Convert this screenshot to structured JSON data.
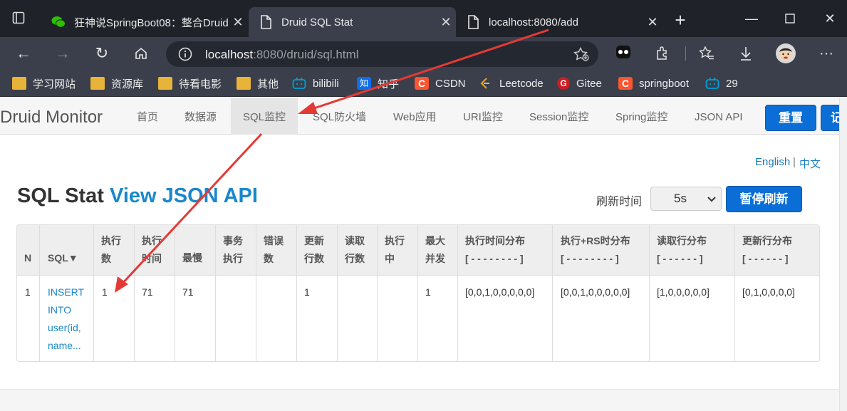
{
  "browser": {
    "tabs": [
      {
        "label": "狂神说SpringBoot08：整合Druid",
        "icon": "wechat-icon",
        "active": false
      },
      {
        "label": "Druid SQL Stat",
        "icon": "page-icon",
        "active": true
      },
      {
        "label": "localhost:8080/add",
        "icon": "page-icon",
        "active": false
      }
    ],
    "address": {
      "host": "localhost",
      "rest": ":8080/druid/sql.html"
    },
    "bookmarks": [
      {
        "label": "学习网站",
        "icon": "folder-icon"
      },
      {
        "label": "资源库",
        "icon": "folder-icon"
      },
      {
        "label": "待看电影",
        "icon": "folder-icon"
      },
      {
        "label": "其他",
        "icon": "folder-icon"
      },
      {
        "label": "bilibili",
        "icon": "bilibili-icon"
      },
      {
        "label": "知乎",
        "icon": "zhihu-icon"
      },
      {
        "label": "CSDN",
        "icon": "csdn-icon"
      },
      {
        "label": "Leetcode",
        "icon": "leetcode-icon"
      },
      {
        "label": "Gitee",
        "icon": "gitee-icon"
      },
      {
        "label": "springboot",
        "icon": "csdn-icon"
      },
      {
        "label": "29",
        "icon": "bilibili-icon"
      }
    ]
  },
  "druid": {
    "brand": "Druid Monitor",
    "menu": [
      "首页",
      "数据源",
      "SQL监控",
      "SQL防火墙",
      "Web应用",
      "URI监控",
      "Session监控",
      "Spring监控",
      "JSON API"
    ],
    "active_menu": "SQL监控",
    "reset_label": "重置",
    "extra_label": "记",
    "lang_en": "English",
    "lang_sep": "|",
    "lang_zh": "中文",
    "title": "SQL Stat",
    "title_link": "View JSON API",
    "refresh_label": "刷新时间",
    "refresh_value": "5s",
    "pause_label": "暂停刷新",
    "table": {
      "headers": [
        [
          "N"
        ],
        [
          "SQL▼"
        ],
        [
          "执行",
          "数"
        ],
        [
          "执行",
          "时间"
        ],
        [
          "最慢"
        ],
        [
          "事务",
          "执行"
        ],
        [
          "错误",
          "数"
        ],
        [
          "更新",
          "行数"
        ],
        [
          "读取",
          "行数"
        ],
        [
          "执行",
          "中"
        ],
        [
          "最大",
          "并发"
        ],
        [
          "执行时间分布",
          "[ - - - - - - - - ]"
        ],
        [
          "执行+RS时分布",
          "[ - - - - - - - - ]"
        ],
        [
          "读取行分布",
          "[ - - - - - - ]"
        ],
        [
          "更新行分布",
          "[ - - - - - - ]"
        ]
      ],
      "rows": [
        {
          "n": "1",
          "sql": [
            "INSERT",
            "INTO",
            "user(id,",
            "name..."
          ],
          "exec_count": "1",
          "exec_time": "71",
          "slowest": "71",
          "tx_exec": "",
          "errors": "",
          "update_rows": "1",
          "read_rows": "",
          "running": "",
          "max_concurrent": "1",
          "exec_hist": "[0,0,1,0,0,0,0,0]",
          "exec_rs_hist": "[0,0,1,0,0,0,0,0]",
          "read_hist": "[1,0,0,0,0,0]",
          "update_hist": "[0,1,0,0,0,0]"
        }
      ]
    }
  },
  "colors": {
    "accent": "#0a6ed6",
    "link": "#1a87c9",
    "annotation": "#e53935",
    "chrome": "#3a3f4b"
  }
}
